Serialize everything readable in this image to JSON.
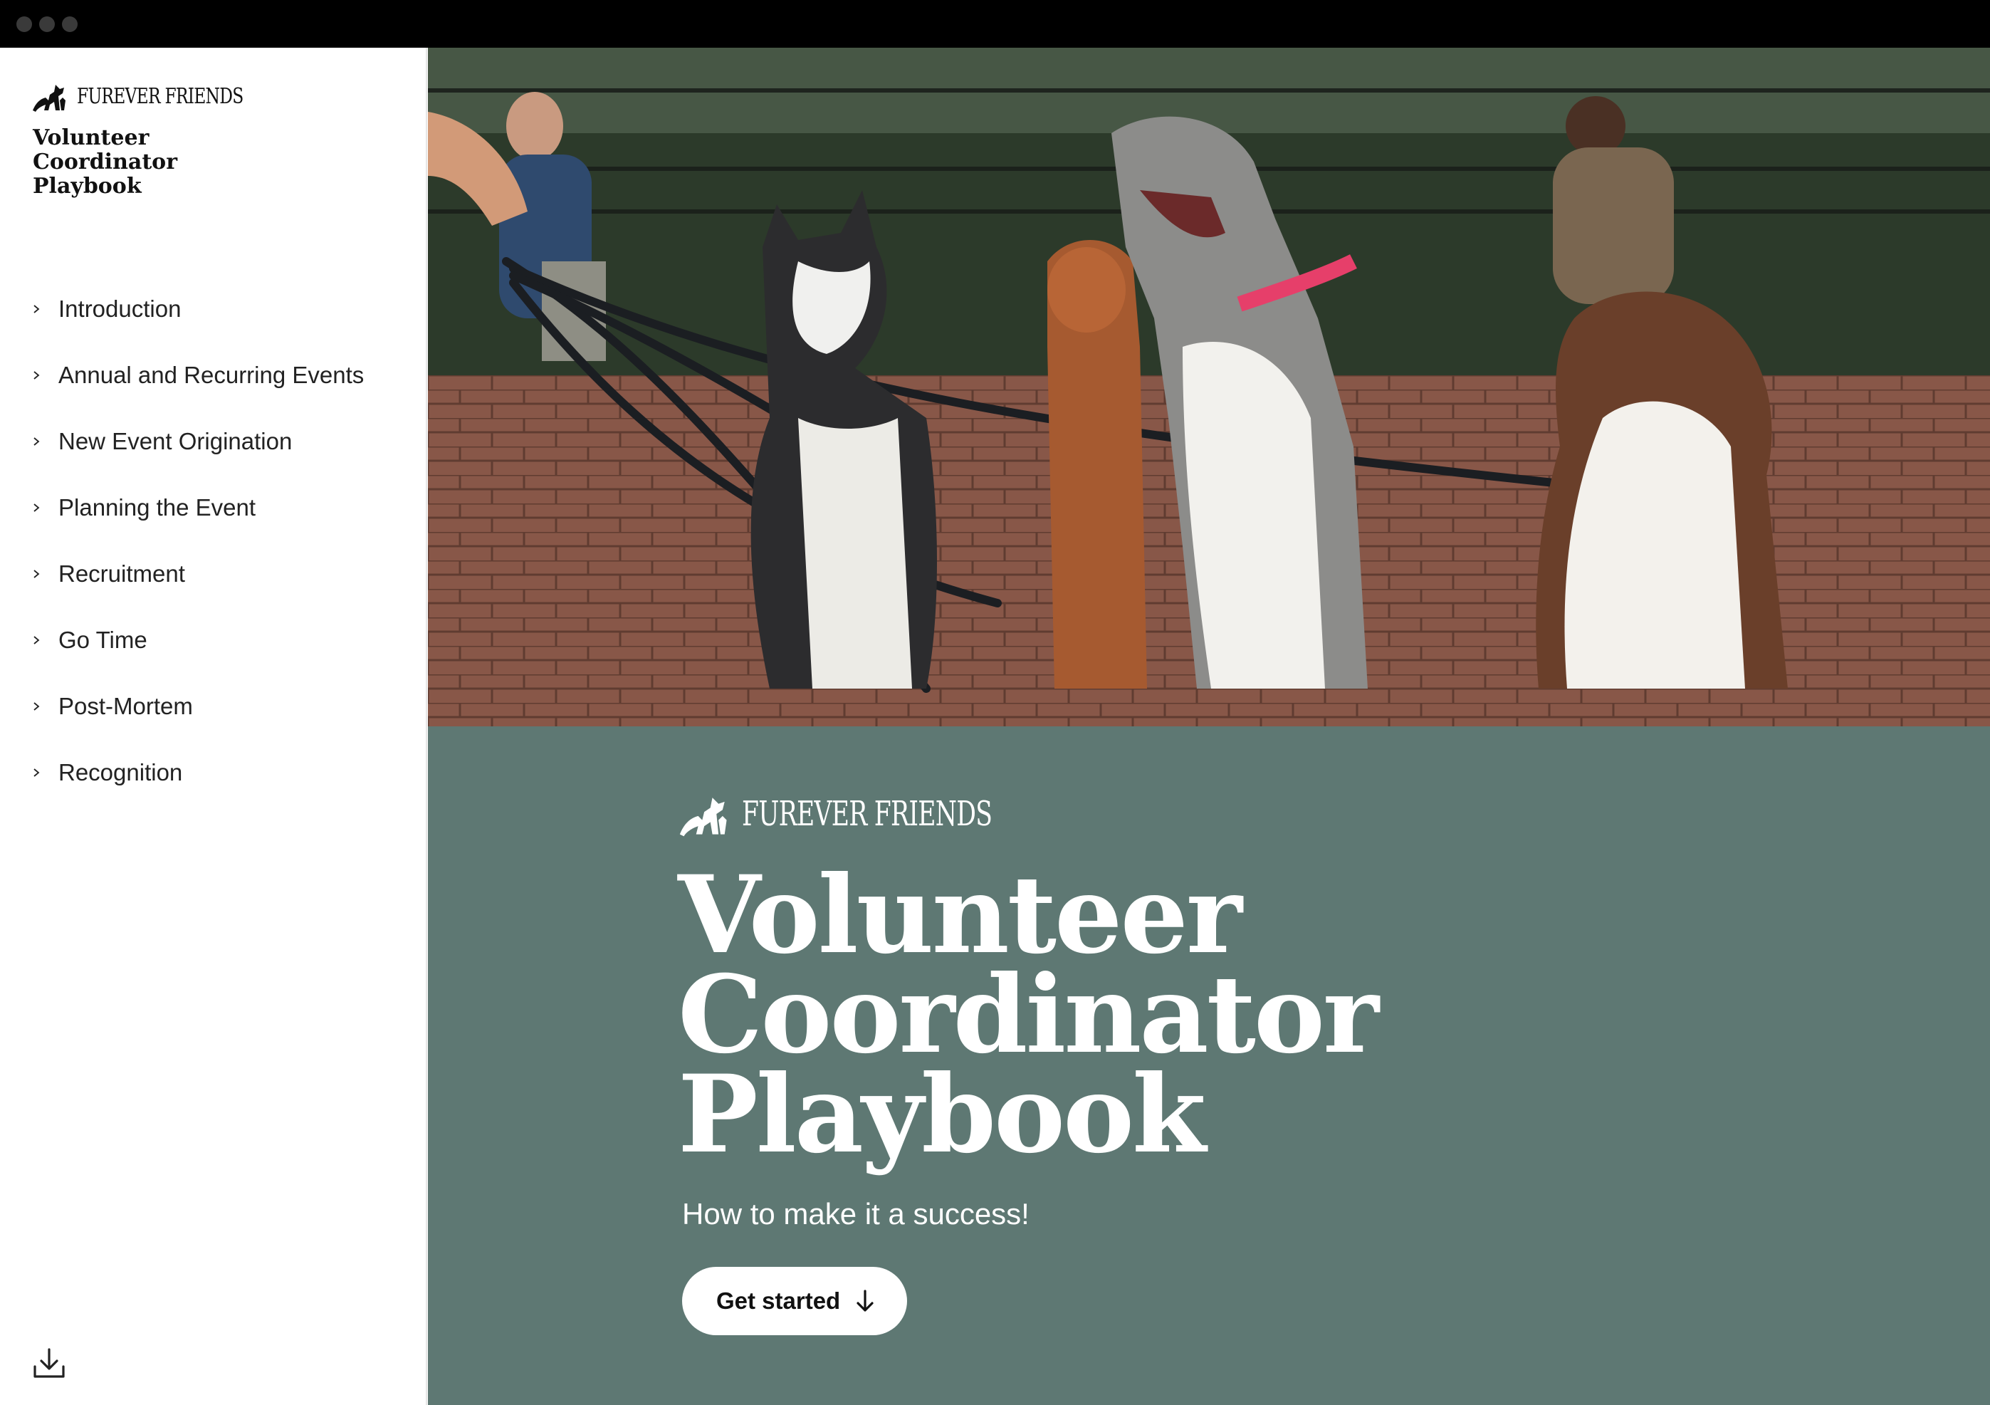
{
  "sidebar": {
    "brand": "FUREVER FRIENDS",
    "title_lines": [
      "Volunteer",
      "Coordinator",
      "Playbook"
    ],
    "nav": [
      {
        "label": "Introduction"
      },
      {
        "label": "Annual and Recurring Events"
      },
      {
        "label": "New Event Origination"
      },
      {
        "label": "Planning the Event"
      },
      {
        "label": "Recruitment"
      },
      {
        "label": "Go Time"
      },
      {
        "label": "Post-Mortem"
      },
      {
        "label": "Recognition"
      }
    ],
    "download_icon": "download-icon"
  },
  "cover": {
    "brand": "FUREVER FRIENDS",
    "title_lines": [
      "Volunteer",
      "Coordinator",
      "Playbook"
    ],
    "subtitle": "How to make it a success!",
    "cta_label": "Get started",
    "cta_icon": "arrow-down-icon"
  },
  "colors": {
    "main_background": "#5e7873",
    "sidebar_background": "#ffffff",
    "titlebar": "#000000",
    "cta_background": "#ffffff",
    "text_on_cover": "#ffffff"
  }
}
